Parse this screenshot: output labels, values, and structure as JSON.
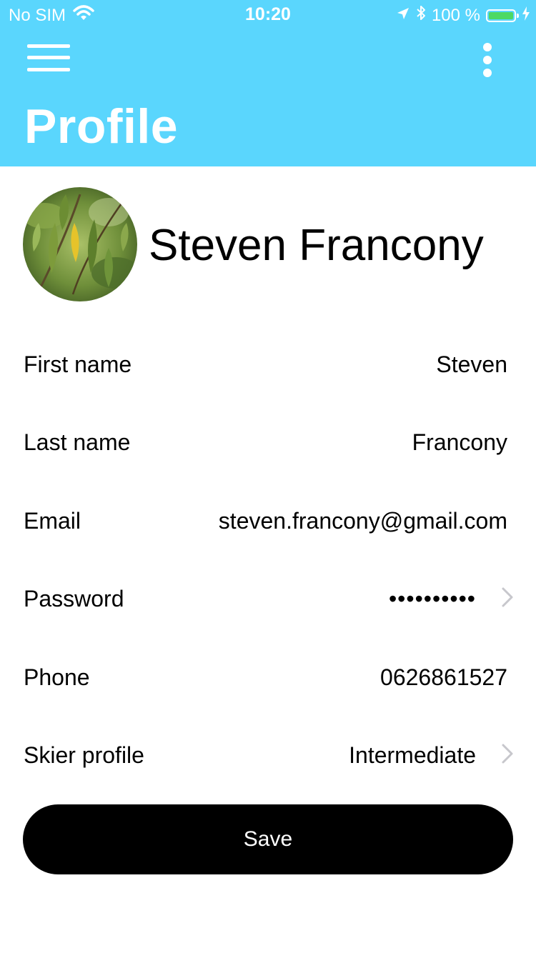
{
  "status_bar": {
    "carrier": "No SIM",
    "time": "10:20",
    "battery_percent": "100 %",
    "battery_level": 1.0
  },
  "header": {
    "title": "Profile",
    "background_color": "#5ad6fd",
    "menu_icon": "hamburger-menu-icon",
    "more_icon": "vertical-ellipsis-icon"
  },
  "profile": {
    "display_name": "Steven Francony",
    "avatar": "leaf-photo-avatar"
  },
  "fields": [
    {
      "label": "First name",
      "value": "Steven",
      "has_chevron": false
    },
    {
      "label": "Last name",
      "value": "Francony",
      "has_chevron": false
    },
    {
      "label": "Email",
      "value": "steven.francony@gmail.com",
      "has_chevron": false
    },
    {
      "label": "Password",
      "value": "••••••••••",
      "has_chevron": true
    },
    {
      "label": "Phone",
      "value": "0626861527",
      "has_chevron": false
    },
    {
      "label": "Skier profile",
      "value": "Intermediate",
      "has_chevron": true
    }
  ],
  "actions": {
    "save_label": "Save"
  }
}
